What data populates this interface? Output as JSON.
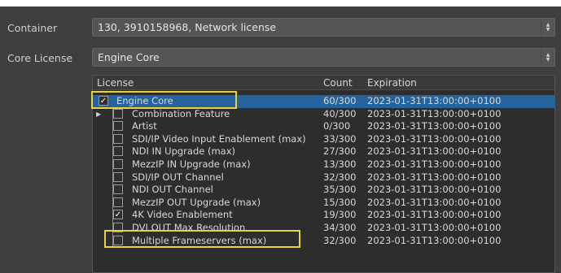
{
  "labels": {
    "container": "Container",
    "core_license": "Core License"
  },
  "container_select": {
    "value": "130, 3910158968, Network license"
  },
  "core_license_select": {
    "value": "Engine Core"
  },
  "table": {
    "headers": {
      "license": "License",
      "count": "Count",
      "expiration": "Expiration"
    },
    "rows": [
      {
        "name": "Engine Core",
        "count": "60/300",
        "expiration": "2023-01-31T13:00:00+0100",
        "checked": true
      },
      {
        "name": "Combination Feature",
        "count": "40/300",
        "expiration": "2023-01-31T13:00:00+0100",
        "checked": false
      },
      {
        "name": "Artist",
        "count": "0/300",
        "expiration": "2023-01-31T13:00:00+0100",
        "checked": false
      },
      {
        "name": "SDI/IP Video Input Enablement (max)",
        "count": "33/300",
        "expiration": "2023-01-31T13:00:00+0100",
        "checked": false
      },
      {
        "name": "NDI IN Upgrade (max)",
        "count": "27/300",
        "expiration": "2023-01-31T13:00:00+0100",
        "checked": false
      },
      {
        "name": "MezzIP IN Upgrade (max)",
        "count": "13/300",
        "expiration": "2023-01-31T13:00:00+0100",
        "checked": false
      },
      {
        "name": "SDI/IP OUT Channel",
        "count": "32/300",
        "expiration": "2023-01-31T13:00:00+0100",
        "checked": false
      },
      {
        "name": "NDI OUT Channel",
        "count": "35/300",
        "expiration": "2023-01-31T13:00:00+0100",
        "checked": false
      },
      {
        "name": "MezzIP OUT Upgrade (max)",
        "count": "15/300",
        "expiration": "2023-01-31T13:00:00+0100",
        "checked": false
      },
      {
        "name": "4K Video Enablement",
        "count": "19/300",
        "expiration": "2023-01-31T13:00:00+0100",
        "checked": true
      },
      {
        "name": "DVI OUT Max Resolution",
        "count": "34/300",
        "expiration": "2023-01-31T13:00:00+0100",
        "checked": false
      },
      {
        "name": "Multiple Frameservers (max)",
        "count": "32/300",
        "expiration": "2023-01-31T13:00:00+0100",
        "checked": false
      }
    ]
  },
  "colors": {
    "background": "#3f3f3f",
    "list_background": "#2d2d2d",
    "highlight": "#e8d33f",
    "combo": "#555555"
  },
  "icons": {
    "expander": "expander-arrow-icon",
    "combo_arrows": "up-down-chevron-icon",
    "checkmark": "checkmark-icon"
  }
}
